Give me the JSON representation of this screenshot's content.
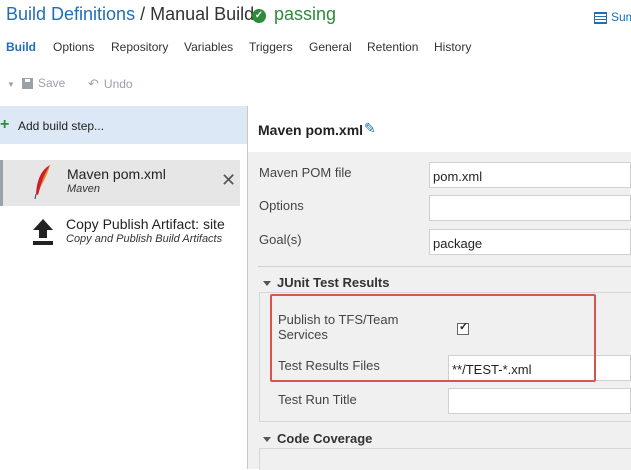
{
  "header": {
    "breadcrumb": "Build Definitions",
    "separator": "/",
    "definition_name": "Manual Build",
    "status": "passing",
    "summary_link": "Sum"
  },
  "tabs": [
    {
      "label": "Build",
      "active": true
    },
    {
      "label": "Options"
    },
    {
      "label": "Repository"
    },
    {
      "label": "Variables"
    },
    {
      "label": "Triggers"
    },
    {
      "label": "General"
    },
    {
      "label": "Retention"
    },
    {
      "label": "History"
    }
  ],
  "toolbar": {
    "save_label": "Save",
    "undo_label": "Undo"
  },
  "steps_panel": {
    "add_label": "Add build step...",
    "steps": [
      {
        "name": "Maven pom.xml",
        "subtitle": "Maven",
        "icon": "feather-icon"
      },
      {
        "name": "Copy Publish Artifact: site",
        "subtitle": "Copy and Publish Build Artifacts",
        "icon": "upload-icon"
      }
    ]
  },
  "detail": {
    "title": "Maven pom.xml",
    "fields": {
      "pom_label": "Maven POM file",
      "pom_value": "pom.xml",
      "options_label": "Options",
      "options_value": "",
      "goals_label": "Goal(s)",
      "goals_value": "package"
    },
    "junit": {
      "heading": "JUnit Test Results",
      "publish_label_line1": "Publish to TFS/Team",
      "publish_label_line2": "Services",
      "publish_checked": true,
      "results_files_label": "Test Results Files",
      "results_files_value": "**/TEST-*.xml",
      "run_title_label": "Test Run Title",
      "run_title_value": ""
    },
    "coverage": {
      "heading": "Code Coverage"
    }
  },
  "colors": {
    "accent": "#1f6fb5",
    "status": "#2e8b3a",
    "highlight": "#d9534f",
    "selected_bg": "#dce8f5"
  }
}
